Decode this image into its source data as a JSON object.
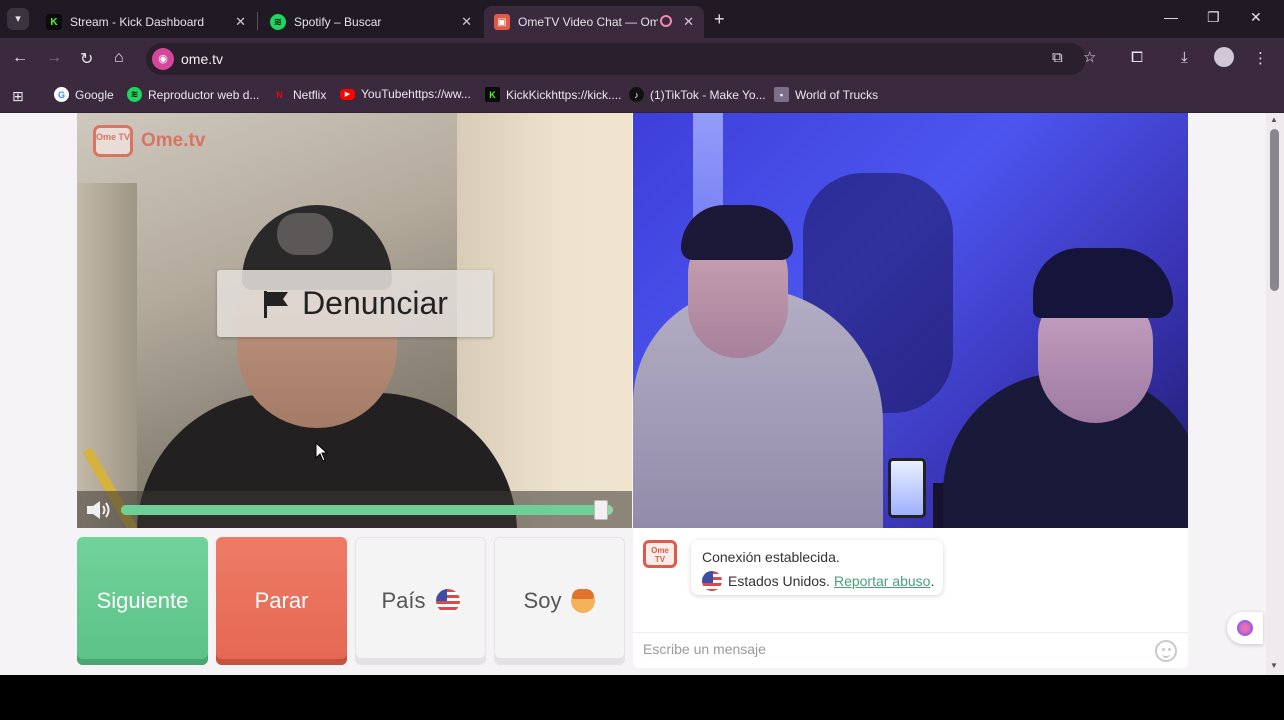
{
  "browser": {
    "tabs": [
      {
        "title": "Stream - Kick Dashboard",
        "favicon": "kick-icon",
        "color": "#53fc18"
      },
      {
        "title": "Spotify – Buscar",
        "favicon": "spotify-icon",
        "color": "#1ed760"
      },
      {
        "title": "OmeTV Video Chat — Ome",
        "favicon": "ometv-icon",
        "color": "#e05a4a",
        "active": true
      }
    ],
    "url": "ome.tv",
    "bookmarks": [
      {
        "label": "Google",
        "icon": "google-icon",
        "color": "#4285f4"
      },
      {
        "label": "Reproductor web d...",
        "icon": "spotify-icon",
        "color": "#1ed760"
      },
      {
        "label": "Netflix",
        "icon": "netflix-icon",
        "color": "#e50914"
      },
      {
        "label": "YouTubehttps://ww...",
        "icon": "youtube-icon",
        "color": "#ff0000"
      },
      {
        "label": "KickKickhttps://kick....",
        "icon": "kick-icon",
        "color": "#53fc18"
      },
      {
        "label": "(1)TikTok - Make Yo...",
        "icon": "tiktok-icon",
        "color": "#111111"
      },
      {
        "label": "World of Trucks",
        "icon": "trucks-icon",
        "color": "#7d6f8a"
      }
    ]
  },
  "ometv": {
    "logo_text": "Ome.tv",
    "logo_badge": "Ome TV",
    "report_label": "Denunciar",
    "volume_level": 0.99,
    "buttons": {
      "next": "Siguiente",
      "stop": "Parar",
      "country": "País",
      "gender": "Soy"
    },
    "chat": {
      "status": "Conexión establecida.",
      "country": "Estados Unidos.",
      "report_link": "Reportar abuso",
      "report_suffix": ".",
      "placeholder": "Escribe un mensaje"
    }
  },
  "colors": {
    "next": "#5bc286",
    "stop": "#e56752",
    "accent": "#e05a4a",
    "link": "#4aa07a"
  }
}
